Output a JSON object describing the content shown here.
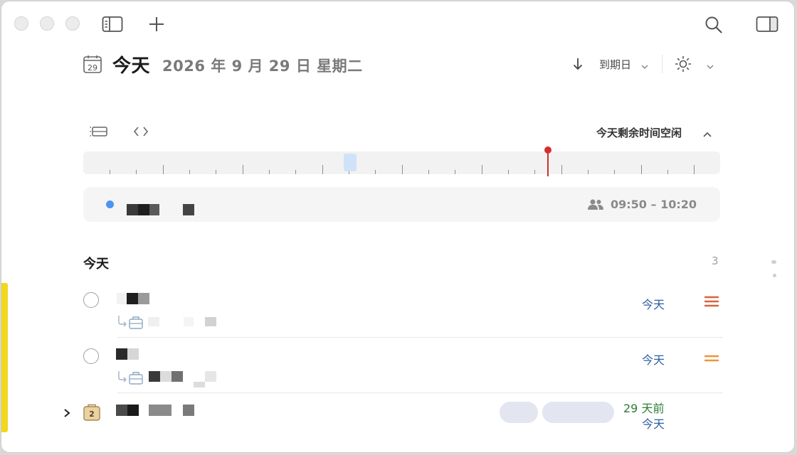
{
  "window": {
    "traffic_lights": [
      "close",
      "minimize",
      "zoom"
    ],
    "toolbar": {
      "sidebar_icon": "sidebar-icon",
      "add_icon": "plus-icon",
      "search_icon": "search-icon",
      "inspector_icon": "inspector-icon"
    }
  },
  "header": {
    "calendar_day": "29",
    "title": "今天",
    "date": "2026 年 9 月 29 日 星期二",
    "sort_label": "到期日",
    "theme_icon": "sun-icon"
  },
  "timeline": {
    "free_time_label": "今天剩余时间空闲",
    "now_color": "#d32f2f"
  },
  "event": {
    "color": "#4e94f0",
    "time": "09:50 – 10:20"
  },
  "section": {
    "title": "今天",
    "count": "3"
  },
  "tasks": [
    {
      "due": "今天",
      "priority_color": "#d9633a",
      "priority_level": "high"
    },
    {
      "due": "今天",
      "priority_color": "#f0933a",
      "priority_level": "medium"
    },
    {
      "project_count": "2",
      "overdue": "29 天前",
      "due": "今天"
    }
  ],
  "colors": {
    "accent_blue": "#2d5ea6",
    "overdue_green": "#2e7d32",
    "window_edge_yellow": "#f0d81c"
  }
}
